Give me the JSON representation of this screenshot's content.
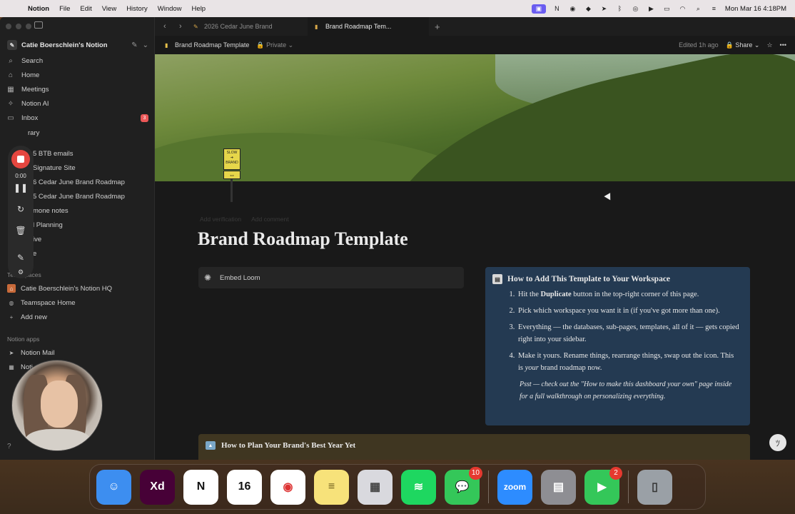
{
  "menubar": {
    "app": "Notion",
    "items": [
      "File",
      "Edit",
      "View",
      "History",
      "Window",
      "Help"
    ],
    "datetime": "Mon Mar 16  4:18PM"
  },
  "tabs": [
    {
      "label": "2026 Cedar June Brand"
    },
    {
      "label": "Brand Roadmap Tem..."
    }
  ],
  "sidebar": {
    "workspace": "Catie Boerschlein's Notion",
    "nav": [
      {
        "label": "Search",
        "icon": "search-icon"
      },
      {
        "label": "Home",
        "icon": "home-icon"
      },
      {
        "label": "Meetings",
        "icon": "calendar-icon"
      },
      {
        "label": "Notion AI",
        "icon": "ai-icon"
      },
      {
        "label": "Inbox",
        "icon": "inbox-icon",
        "badge": "3"
      }
    ],
    "pages": [
      "rary",
      "5 BTB emails",
      "Signature Site",
      "6 Cedar June Brand Roadmap",
      "5 Cedar June Brand Roadmap",
      "mone notes",
      "l Planning",
      "ive",
      "e"
    ],
    "teamspaces_label": "Teamspaces",
    "teamspaces": [
      {
        "label": "Catie Boerschlein's Notion HQ"
      },
      {
        "label": "Teamspace Home"
      },
      {
        "label": "Add new"
      }
    ],
    "apps_label": "Notion apps",
    "apps": [
      {
        "label": "Notion Mail"
      },
      {
        "label": "Noti"
      }
    ]
  },
  "recorder": {
    "time": "0:00"
  },
  "page_header": {
    "title": "Brand Roadmap Template",
    "privacy": "Private",
    "edited": "Edited 1h ago",
    "share": "Share"
  },
  "sign": {
    "line1": "SLOW",
    "line2": "BRAND"
  },
  "page": {
    "faint_actions": [
      "Add verification",
      "Add comment"
    ],
    "title": "Brand Roadmap Template",
    "embed": "Embed Loom",
    "callout": {
      "heading": "How to Add This Template to Your Workspace",
      "step1_a": "Hit the ",
      "step1_b": "Duplicate",
      "step1_c": " button in the top-right corner of this page.",
      "step2": "Pick which workspace you want it in (if you've got more than one).",
      "step3": "Everything — the databases, sub-pages, templates, all of it — gets copied right into your sidebar.",
      "step4_a": "Make it yours. Rename things, rearrange things, swap out the icon. This is ",
      "step4_b": "your",
      "step4_c": " brand roadmap now.",
      "psst": "Psst — check out the \"How to make this dashboard your own\" page inside for a full walkthrough on personalizing everything."
    },
    "plan_heading": "How to Plan Your Brand's Best Year Yet"
  },
  "dock": [
    {
      "name": "finder",
      "label": "",
      "color": "#3d8ef0"
    },
    {
      "name": "adobe-xd",
      "label": "Xd",
      "color": "#470137"
    },
    {
      "name": "notion",
      "label": "N",
      "color": "#ffffff"
    },
    {
      "name": "calendar",
      "label": "16",
      "color": "#ffffff"
    },
    {
      "name": "chrome",
      "label": "",
      "color": "#ffffff"
    },
    {
      "name": "notes",
      "label": "",
      "color": "#f7e27a"
    },
    {
      "name": "launchpad",
      "label": "",
      "color": "#d9d9de"
    },
    {
      "name": "spotify",
      "label": "",
      "color": "#1ed760"
    },
    {
      "name": "messages",
      "label": "",
      "color": "#34c759",
      "badge": "10"
    },
    {
      "name": "zoom",
      "label": "zoom",
      "color": "#2d8cff"
    },
    {
      "name": "calculator",
      "label": "",
      "color": "#8e8e93"
    },
    {
      "name": "facetime",
      "label": "",
      "color": "#34c759",
      "badge": "2"
    },
    {
      "name": "trash",
      "label": "",
      "color": "#9aa0a6"
    }
  ]
}
